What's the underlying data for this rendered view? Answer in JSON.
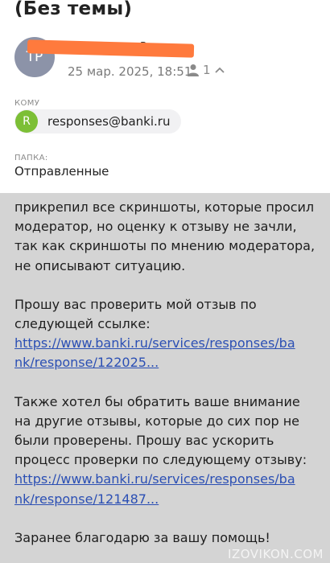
{
  "header": {
    "subject": "(Без темы)"
  },
  "sender": {
    "initials": "TP",
    "name_fragment": "в",
    "date": "25 мар. 2025, 18:51",
    "recipient_count": "1"
  },
  "to": {
    "label": "КОМУ",
    "chip_initial": "R",
    "address": "responses@banki.ru"
  },
  "folder": {
    "label": "ПАПКА:",
    "value": "Отправленные"
  },
  "body": {
    "lines1": [
      "прикрепил все скриншоты, которые просил",
      "модератор, но оценку к отзыву не зачли,",
      "так как скриншоты по мнению модератора,",
      "не описывают ситуацию."
    ],
    "lines2": [
      "Прошу вас проверить мой отзыв по",
      "следующей ссылке:"
    ],
    "link1": [
      "https://www.banki.ru/services/responses/ba",
      "nk/response/122025..."
    ],
    "lines3": [
      "Также хотел бы обратить ваше внимание",
      "на другие отзывы, которые до сих пор не",
      "были проверены. Прошу вас ускорить",
      "процесс проверки по следующему отзыву:"
    ],
    "link2": [
      "https://www.banki.ru/services/responses/ba",
      "nk/response/121487..."
    ],
    "closing": "Заранее благодарю за вашу помощь!"
  },
  "watermark": "IZOVIKON.COM",
  "icons": {
    "recipients": "person-icon",
    "expand": "chevron-up-icon"
  },
  "colors": {
    "redaction": "#ff7a3d",
    "avatar": "#8c93a8",
    "chip_avatar": "#7cbf36",
    "link": "#2b4fb4",
    "body_background": "#d4d4d4"
  }
}
